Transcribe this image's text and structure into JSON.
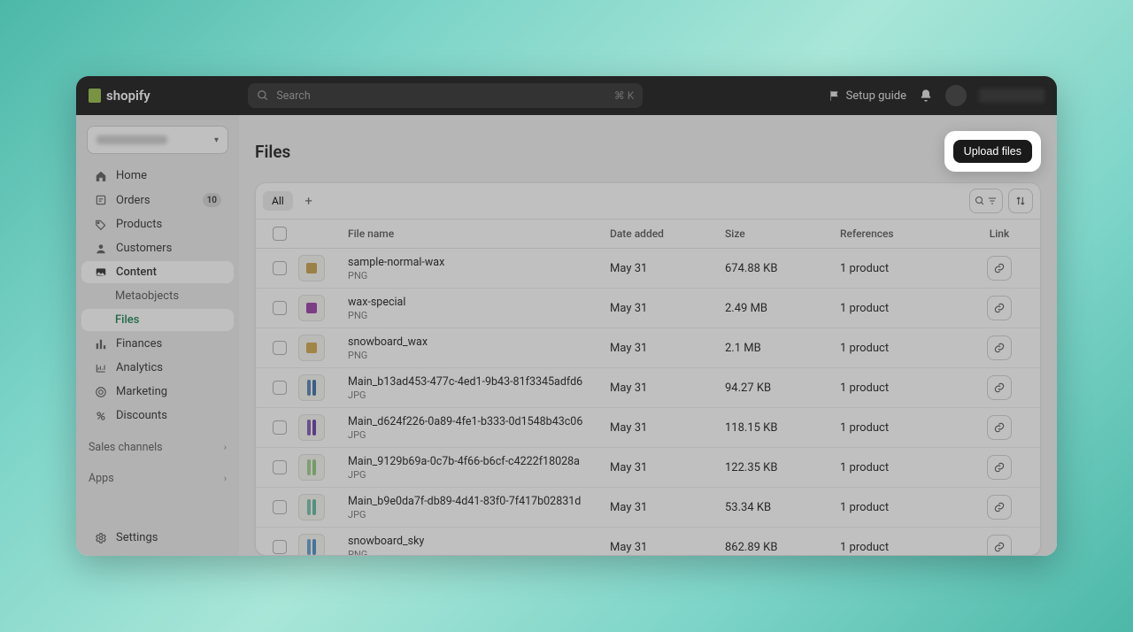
{
  "brand": "shopify",
  "topbar": {
    "search_placeholder": "Search",
    "shortcut": "⌘ K",
    "setup_guide": "Setup guide"
  },
  "sidebar": {
    "home": "Home",
    "orders": "Orders",
    "orders_badge": "10",
    "products": "Products",
    "customers": "Customers",
    "content": "Content",
    "metaobjects": "Metaobjects",
    "files": "Files",
    "finances": "Finances",
    "analytics": "Analytics",
    "marketing": "Marketing",
    "discounts": "Discounts",
    "sales_channels": "Sales channels",
    "apps": "Apps",
    "settings": "Settings"
  },
  "page": {
    "title": "Files",
    "upload": "Upload files",
    "tab_all": "All"
  },
  "columns": {
    "file_name": "File name",
    "date_added": "Date added",
    "size": "Size",
    "references": "References",
    "link": "Link"
  },
  "rows": [
    {
      "name": "sample-normal-wax",
      "ext": "PNG",
      "date": "May 31",
      "size": "674.88 KB",
      "refs": "1 product",
      "swatch": "#c9a34a",
      "kind": "box"
    },
    {
      "name": "wax-special",
      "ext": "PNG",
      "date": "May 31",
      "size": "2.49 MB",
      "refs": "1 product",
      "swatch": "#9b3fa8",
      "kind": "box"
    },
    {
      "name": "snowboard_wax",
      "ext": "PNG",
      "date": "May 31",
      "size": "2.1 MB",
      "refs": "1 product",
      "swatch": "#d1a94a",
      "kind": "box"
    },
    {
      "name": "Main_b13ad453-477c-4ed1-9b43-81f3345adfd6",
      "ext": "JPG",
      "date": "May 31",
      "size": "94.27 KB",
      "refs": "1 product",
      "swatch": "#3a6fa8",
      "kind": "bars"
    },
    {
      "name": "Main_d624f226-0a89-4fe1-b333-0d1548b43c06",
      "ext": "JPG",
      "date": "May 31",
      "size": "118.15 KB",
      "refs": "1 product",
      "swatch": "#6a3fa8",
      "kind": "bars"
    },
    {
      "name": "Main_9129b69a-0c7b-4f66-b6cf-c4222f18028a",
      "ext": "JPG",
      "date": "May 31",
      "size": "122.35 KB",
      "refs": "1 product",
      "swatch": "#8fc97e",
      "kind": "bars"
    },
    {
      "name": "Main_b9e0da7f-db89-4d41-83f0-7f417b02831d",
      "ext": "JPG",
      "date": "May 31",
      "size": "53.34 KB",
      "refs": "1 product",
      "swatch": "#5fb8a0",
      "kind": "bars"
    },
    {
      "name": "snowboard_sky",
      "ext": "PNG",
      "date": "May 31",
      "size": "862.89 KB",
      "refs": "1 product",
      "swatch": "#4a8fc9",
      "kind": "bars"
    }
  ]
}
